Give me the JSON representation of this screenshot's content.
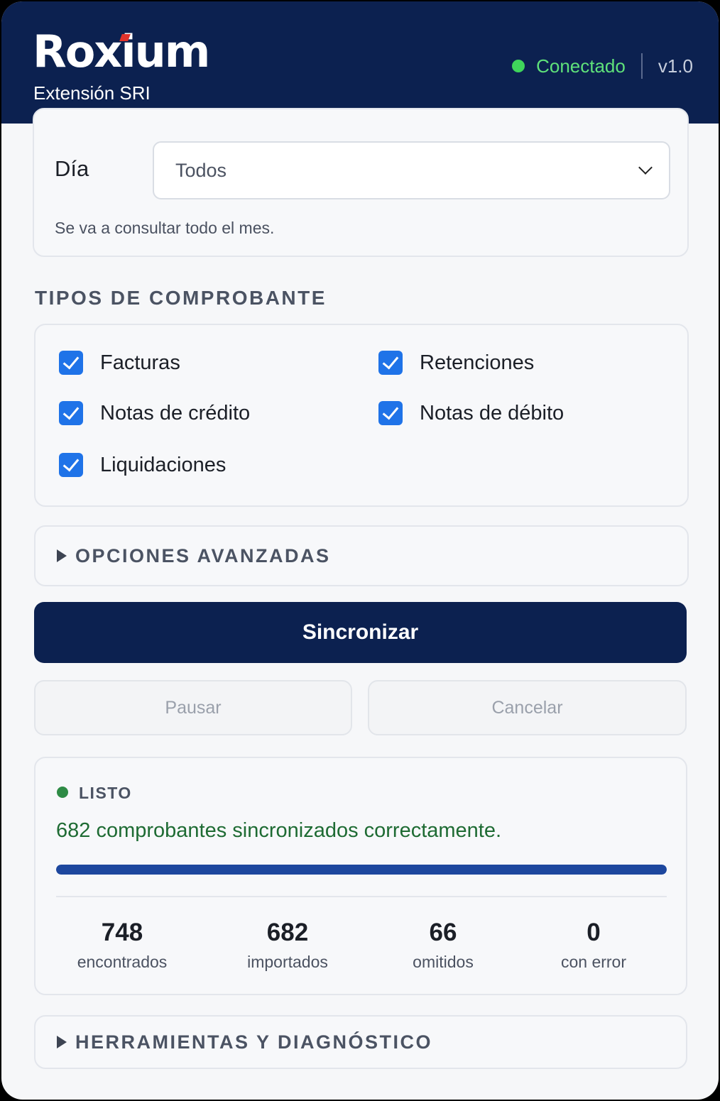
{
  "header": {
    "logo_text": "Roxium",
    "subtitle": "Extensión SRI",
    "connection_status": "Conectado",
    "version": "v1.0",
    "status_color": "#3fd55b"
  },
  "day_filter": {
    "label": "Día",
    "selected": "Todos",
    "hint": "Se va a consultar todo el mes."
  },
  "types": {
    "title": "TIPOS DE COMPROBANTE",
    "items": [
      {
        "label": "Facturas",
        "checked": true
      },
      {
        "label": "Retenciones",
        "checked": true
      },
      {
        "label": "Notas de crédito",
        "checked": true
      },
      {
        "label": "Notas de débito",
        "checked": true
      },
      {
        "label": "Liquidaciones",
        "checked": true
      }
    ]
  },
  "advanced": {
    "title": "OPCIONES AVANZADAS"
  },
  "actions": {
    "sync_label": "Sincronizar",
    "pause_label": "Pausar",
    "cancel_label": "Cancelar"
  },
  "status": {
    "label": "LISTO",
    "message": "682 comprobantes sincronizados correctamente.",
    "progress": 1.0,
    "stats": [
      {
        "value": "748",
        "label": "encontrados"
      },
      {
        "value": "682",
        "label": "importados"
      },
      {
        "value": "66",
        "label": "omitidos"
      },
      {
        "value": "0",
        "label": "con error"
      }
    ]
  },
  "tools": {
    "title": "HERRAMIENTAS Y DIAGNÓSTICO"
  }
}
